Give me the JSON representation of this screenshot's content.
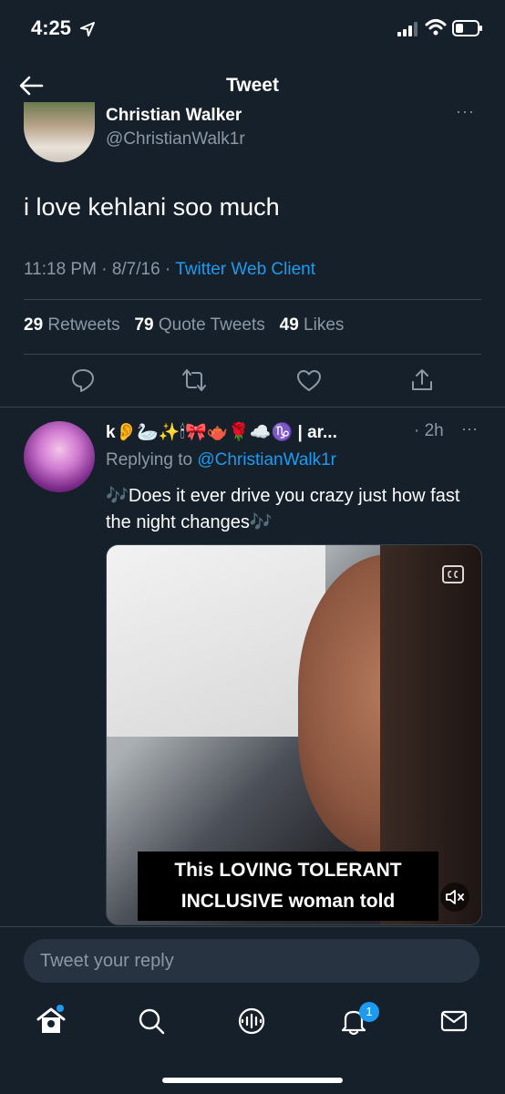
{
  "status_bar": {
    "time": "4:25"
  },
  "header": {
    "title": "Tweet"
  },
  "tweet": {
    "author_name": "Christian Walker",
    "author_handle": "@ChristianWalk1r",
    "text": "i love kehlani soo much",
    "time": "11:18 PM",
    "date": "8/7/16",
    "client": "Twitter Web Client",
    "retweets": "29",
    "retweets_label": "Retweets",
    "quotes": "79",
    "quotes_label": "Quote Tweets",
    "likes": "49",
    "likes_label": "Likes",
    "more": "···"
  },
  "reply": {
    "name_start": "k",
    "name_emojis": "👂🦢✨🕯🎀🫖🌹☁️♑",
    "name_end": "| ar...",
    "time": "· 2h",
    "replying_prefix": "Replying to",
    "replying_handle": "@ChristianWalk1r",
    "text": "🎶Does it ever drive you crazy just how fast the night changes🎶",
    "caption": "This LOVING TOLERANT INCLUSIVE woman told",
    "more": "···"
  },
  "composer": {
    "placeholder": "Tweet your reply"
  },
  "tabbar": {
    "notification_count": "1"
  },
  "colors": {
    "background": "#15202b",
    "accent": "#1d9bf0",
    "muted": "#8b98a5",
    "divider": "#38444d"
  }
}
